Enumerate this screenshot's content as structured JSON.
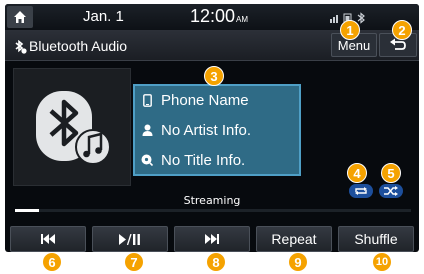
{
  "status_bar": {
    "date": "Jan.  1",
    "time": "12:00",
    "ampm": "AM",
    "icons": [
      "signal-icon",
      "battery-icon",
      "bluetooth-status-icon"
    ]
  },
  "title_bar": {
    "title": "Bluetooth Audio",
    "menu_label": "Menu",
    "source_icon": "bluetooth-audio-icon",
    "back_icon": "back-arrow-icon"
  },
  "track_info": {
    "phone_name": "Phone Name",
    "artist": "No Artist Info.",
    "title": "No Title Info."
  },
  "playback": {
    "status_text": "Streaming",
    "progress": 0.06,
    "repeat_icon": "repeat-icon",
    "shuffle_icon": "shuffle-icon"
  },
  "controls": {
    "previous_icon": "previous-track-icon",
    "play_pause_icon": "play-pause-icon",
    "next_icon": "next-track-icon",
    "repeat_label": "Repeat",
    "shuffle_label": "Shuffle"
  },
  "callouts": [
    "1",
    "2",
    "3",
    "4",
    "5",
    "6",
    "7",
    "8",
    "9",
    "10"
  ],
  "colors": {
    "accent": "#f5a200",
    "info_box": "#2f6b86",
    "info_border": "#4f9fc6",
    "control_icon": "#1d4f9c"
  }
}
